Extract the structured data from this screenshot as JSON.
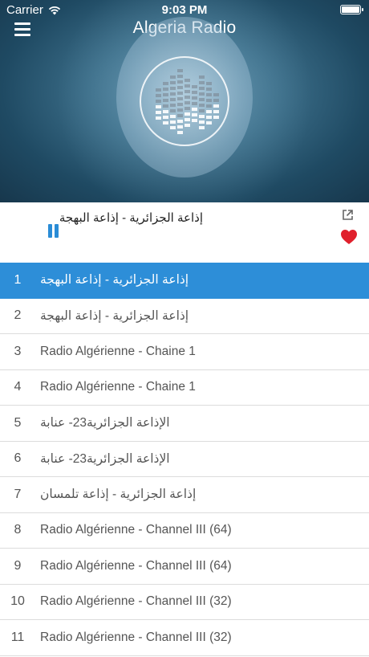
{
  "status_bar": {
    "carrier": "Carrier",
    "time": "9:03 PM"
  },
  "header": {
    "title": "Algeria Radio",
    "menu_icon": "hamburger-menu-icon"
  },
  "artwork": {
    "icon": "equalizer-icon"
  },
  "now_playing": {
    "title": "إذاعة الجزائرية - إذاعة البهجة",
    "state": "playing",
    "pause_icon": "pause-icon",
    "share_icon": "external-link-icon",
    "favorite_icon": "heart-icon",
    "favorite_color": "#e0202c"
  },
  "colors": {
    "accent": "#2d8ed8",
    "active_row": "#2d8ed8"
  },
  "stations": [
    {
      "num": "1",
      "name": "إذاعة الجزائرية - إذاعة البهجة",
      "active": true
    },
    {
      "num": "2",
      "name": "إذاعة الجزائرية - إذاعة البهجة",
      "active": false
    },
    {
      "num": "3",
      "name": "Radio Algérienne - Chaine 1",
      "active": false
    },
    {
      "num": "4",
      "name": "Radio Algérienne - Chaine 1",
      "active": false
    },
    {
      "num": "5",
      "name": "الإذاعة الجزائرية23- عنابة",
      "active": false
    },
    {
      "num": "6",
      "name": "الإذاعة الجزائرية23- عنابة",
      "active": false
    },
    {
      "num": "7",
      "name": "إذاعة الجزائرية - إذاعة تلمسان",
      "active": false
    },
    {
      "num": "8",
      "name": "Radio Algérienne - Channel III (64)",
      "active": false
    },
    {
      "num": "9",
      "name": "Radio Algérienne - Channel III (64)",
      "active": false
    },
    {
      "num": "10",
      "name": "Radio Algérienne - Channel III (32)",
      "active": false
    },
    {
      "num": "11",
      "name": "Radio Algérienne - Channel III (32)",
      "active": false
    }
  ]
}
